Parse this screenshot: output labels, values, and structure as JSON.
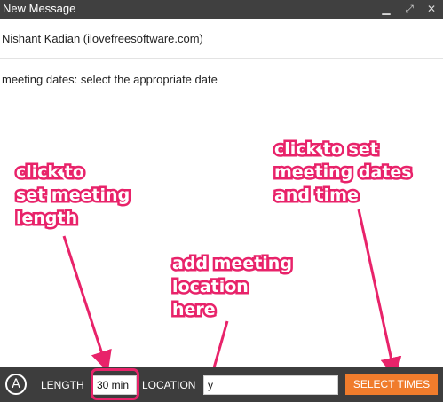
{
  "window": {
    "title": "New Message",
    "minimize_icon": "minimize-icon",
    "expand_icon": "expand-icon",
    "close_icon": "close-icon"
  },
  "compose": {
    "to": "Nishant Kadian (ilovefreesoftware.com)",
    "subject": "meeting dates: select the appropriate date",
    "body": ""
  },
  "annotations": {
    "length": "click to\nset meeting\nlength",
    "location": "add meeting\nlocation\nhere",
    "times": "click to set\nmeeting dates\nand time",
    "color": "#e8236a"
  },
  "toolbar": {
    "logo": "A",
    "length_label": "LENGTH",
    "length_value": "30 min",
    "location_label": "LOCATION",
    "location_value": "y",
    "select_times_label": "SELECT TIMES",
    "accent_color": "#f07c2c"
  }
}
